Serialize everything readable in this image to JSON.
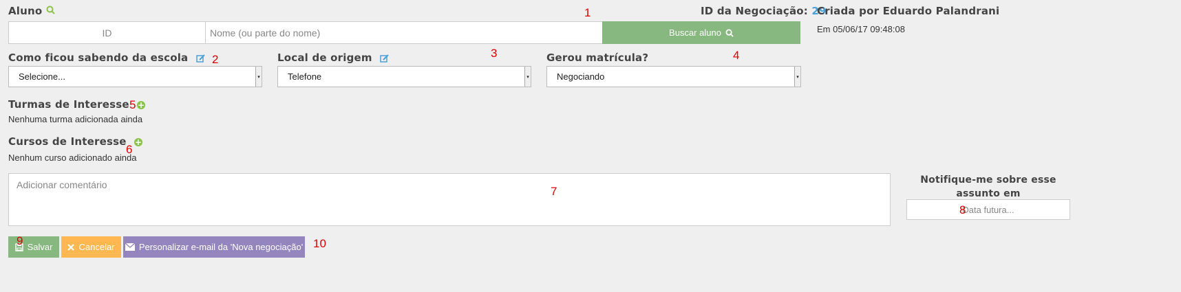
{
  "aluno": {
    "label": "Aluno",
    "id_placeholder": "ID",
    "name_placeholder": "Nome (ou parte do nome)",
    "search_button": "Buscar aluno"
  },
  "negotiation": {
    "id_label": "ID da Negociação:",
    "id_value": "29",
    "created_by": "Criada por Eduardo Palandrani",
    "created_at": "Em 05/06/17 09:48:08"
  },
  "fields": {
    "como_ficou_label": "Como ficou sabendo da escola",
    "como_ficou_value": "Selecione...",
    "local_origem_label": "Local de origem",
    "local_origem_value": "Telefone",
    "gerou_matricula_label": "Gerou matrícula?",
    "gerou_matricula_value": "Negociando"
  },
  "turmas": {
    "label": "Turmas de Interesse",
    "empty": "Nenhuma turma adicionada ainda"
  },
  "cursos": {
    "label": "Cursos de Interesse",
    "empty": "Nenhum curso adicionado ainda"
  },
  "comment": {
    "placeholder": "Adicionar comentário"
  },
  "notify": {
    "label": "Notifique-me sobre esse assunto em",
    "placeholder": "Data futura..."
  },
  "actions": {
    "save": "Salvar",
    "cancel": "Cancelar",
    "email": "Personalizar e-mail da 'Nova negociação'"
  },
  "markers": [
    "1",
    "2",
    "3",
    "4",
    "5",
    "6",
    "7",
    "8",
    "9",
    "10"
  ],
  "colors": {
    "green": "#87b87f",
    "orange": "#ffb752",
    "purple": "#9585bf",
    "blue_accent": "#4aa0d8",
    "marker_red": "#e00000"
  }
}
